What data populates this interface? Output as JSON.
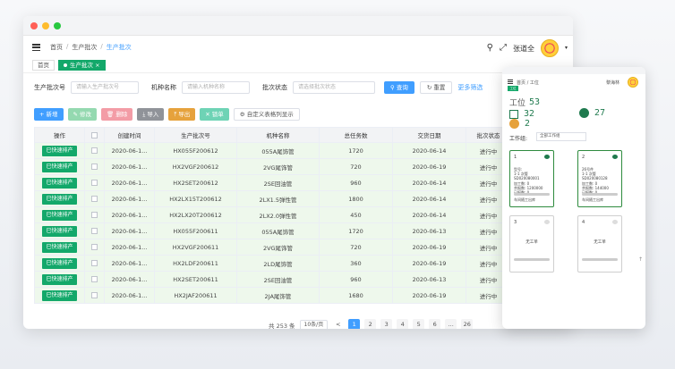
{
  "colors": {
    "accent": "#409eff",
    "green": "#13a86a",
    "orange": "#e6a23c"
  },
  "window": {
    "dots": [
      "#ff5f57",
      "#febc2e",
      "#28c840"
    ],
    "breadcrumb": [
      "首页",
      "生产批次",
      "生产批次"
    ],
    "user_name": "张道全",
    "icons": [
      "menu-icon",
      "search-icon",
      "fullscreen-icon",
      "chevron-down-icon"
    ]
  },
  "tabs": [
    "首页",
    "生产批次"
  ],
  "filters": {
    "f1_label": "生产批次号",
    "f1_placeholder": "请输入生产批次号",
    "f2_label": "机种名称",
    "f2_placeholder": "请输入机种名称",
    "f3_label": "批次状态",
    "f3_placeholder": "请选择批次状态",
    "query": "查询",
    "reset": "重置",
    "more": "更多筛选"
  },
  "toolbar": {
    "add": "+ 新增",
    "edit": "修改",
    "del": "删除",
    "imp": "导入",
    "exp": "导出",
    "dup": "锁单",
    "custom": "自定义表格列显示"
  },
  "table": {
    "headers": [
      "操作",
      "",
      "创建时间",
      "生产批次号",
      "机种名称",
      "总任务数",
      "交货日期",
      "批次状态"
    ],
    "action_label": "已快速排产",
    "rows": [
      [
        "2020-06-1...",
        "HX055F200612",
        "055A尾饰管",
        "1720",
        "2020-06-14",
        "进行中"
      ],
      [
        "2020-06-1...",
        "HX2VGF200612",
        "2VG尾饰管",
        "720",
        "2020-06-19",
        "进行中"
      ],
      [
        "2020-06-1...",
        "HX2SET200612",
        "2SE回油管",
        "960",
        "2020-06-14",
        "进行中"
      ],
      [
        "2020-06-1...",
        "HX2LX15T200612",
        "2LX1.5弹性管",
        "1800",
        "2020-06-14",
        "进行中"
      ],
      [
        "2020-06-1...",
        "HX2LX20T200612",
        "2LX2.0弹性管",
        "450",
        "2020-06-14",
        "进行中"
      ],
      [
        "2020-06-1...",
        "HX055F200611",
        "055A尾饰管",
        "1720",
        "2020-06-13",
        "进行中"
      ],
      [
        "2020-06-1...",
        "HX2VGF200611",
        "2VG尾饰管",
        "720",
        "2020-06-19",
        "进行中"
      ],
      [
        "2020-06-1...",
        "HX2LDF200611",
        "2LD尾饰管",
        "360",
        "2020-06-19",
        "进行中"
      ],
      [
        "2020-06-1...",
        "HX2SET200611",
        "2SE回油管",
        "960",
        "2020-06-13",
        "进行中"
      ],
      [
        "2020-06-1...",
        "HX2JAF200611",
        "2JA尾饰管",
        "1680",
        "2020-06-19",
        "进行中"
      ]
    ]
  },
  "pager": {
    "total": "共 253 条",
    "size": "10条/页",
    "pages": [
      "1",
      "2",
      "3",
      "4",
      "5",
      "6",
      "...",
      "26"
    ],
    "prev": "<"
  },
  "panel": {
    "breadcrumb": "首页 / 工位",
    "user_name": "黎海林",
    "tag": "工位",
    "station_label": "工位",
    "station_count": "53",
    "idle_count": "32",
    "running_count": "27",
    "warn_count": "2",
    "workgroup_label": "工作组:",
    "workgroup_value": "全部工作组",
    "cards": [
      {
        "n": "1",
        "lines": [
          "型号:",
          "1-1  次管",
          "SD020080001",
          "加工数:  0",
          "余报数:  1200000",
          "已报数:  0"
        ],
        "foot": "车间随工出库"
      },
      {
        "n": "2",
        "lines": [
          "26号件",
          "1-1  次管",
          "SD020080128",
          "加工数:  0",
          "余报数:  144000",
          "已报数:  0"
        ],
        "foot": "车间随工出库"
      },
      {
        "n": "3",
        "center": "无工单"
      },
      {
        "n": "4",
        "center": "无工单"
      }
    ]
  }
}
